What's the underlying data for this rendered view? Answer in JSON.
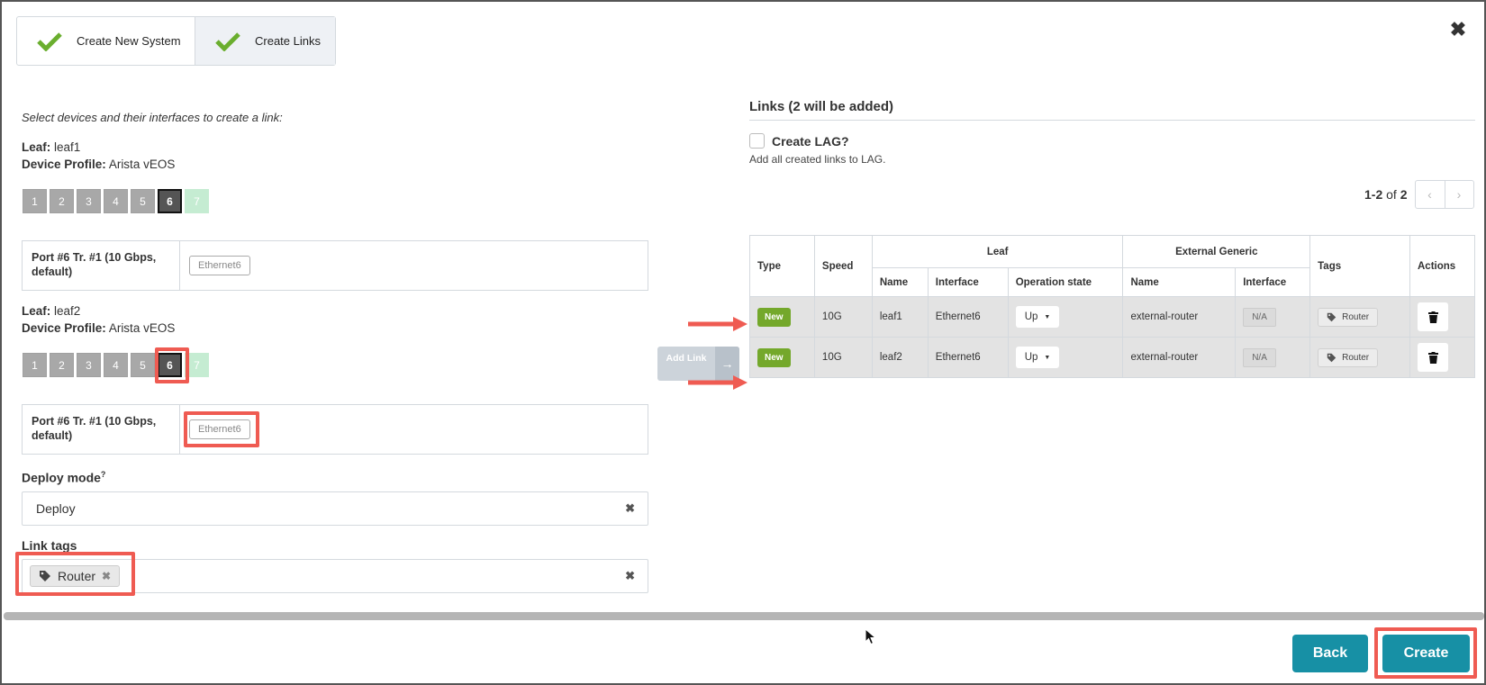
{
  "wizard": {
    "steps": [
      {
        "label": "Create New System",
        "icon": "check-icon"
      },
      {
        "label": "Create Links",
        "icon": "check-icon"
      }
    ],
    "close_icon": "close-icon"
  },
  "left": {
    "intro": "Select devices and their interfaces to create a link:",
    "leaf_label": "Leaf:",
    "profile_label": "Device Profile:",
    "leaves": [
      {
        "name": "leaf1",
        "profile": "Arista vEOS",
        "ports": [
          "1",
          "2",
          "3",
          "4",
          "5",
          "6",
          "7"
        ],
        "selected_port": "6",
        "port_label": "Port #6 Tr. #1 (10 Gbps, default)",
        "interface": "Ethernet6"
      },
      {
        "name": "leaf2",
        "profile": "Arista vEOS",
        "ports": [
          "1",
          "2",
          "3",
          "4",
          "5",
          "6",
          "7"
        ],
        "selected_port": "6",
        "port_label": "Port #6 Tr. #1 (10 Gbps, default)",
        "interface": "Ethernet6"
      }
    ],
    "deploy_mode": {
      "label": "Deploy mode",
      "help": "?",
      "value": "Deploy",
      "clear": "✖"
    },
    "link_tags": {
      "label": "Link tags",
      "tag": "Router",
      "tag_remove": "✖",
      "clear": "✖"
    }
  },
  "add_link": {
    "label": "Add Link",
    "arrow": "→"
  },
  "right": {
    "title": "Links (2 will be added)",
    "create_lag": {
      "label": "Create LAG?",
      "checked": false,
      "help": "Add all created links to LAG."
    },
    "pager": {
      "range": "1-2",
      "of_text": "of",
      "total": "2",
      "prev": "‹",
      "next": "›"
    },
    "table": {
      "group_headers": {
        "type": "Type",
        "speed": "Speed",
        "leaf": "Leaf",
        "external": "External Generic",
        "tags": "Tags",
        "actions": "Actions"
      },
      "sub_headers": {
        "leaf_name": "Name",
        "leaf_interface": "Interface",
        "operation_state": "Operation state",
        "ext_name": "Name",
        "ext_interface": "Interface"
      },
      "rows": [
        {
          "type": "New",
          "speed": "10G",
          "leaf_name": "leaf1",
          "leaf_interface": "Ethernet6",
          "op_state": "Up",
          "ext_name": "external-router",
          "ext_interface": "N/A",
          "tag": "Router"
        },
        {
          "type": "New",
          "speed": "10G",
          "leaf_name": "leaf2",
          "leaf_interface": "Ethernet6",
          "op_state": "Up",
          "ext_name": "external-router",
          "ext_interface": "N/A",
          "tag": "Router"
        }
      ]
    }
  },
  "footer": {
    "back": "Back",
    "create": "Create"
  },
  "colors": {
    "accent": "#1790a5",
    "highlight": "#ef5b52",
    "new_badge": "#74a82b",
    "check": "#6aae2e"
  }
}
